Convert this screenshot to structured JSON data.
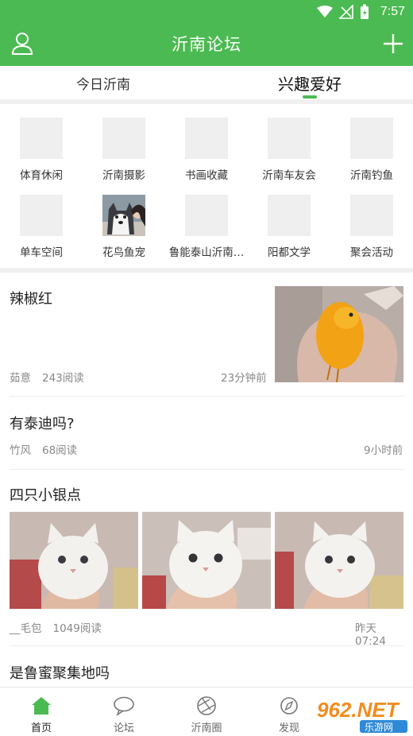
{
  "status_bar": {
    "time": "7:57",
    "icons": [
      "wifi-icon",
      "no-signal-icon",
      "battery-icon"
    ]
  },
  "header": {
    "title": "沂南论坛",
    "left_icon": "user-icon",
    "right_icon": "plus-icon"
  },
  "tabs": [
    {
      "label": "今日沂南",
      "active": false
    },
    {
      "label": "兴趣爱好",
      "active": true
    }
  ],
  "categories": [
    {
      "label": "体育休闲"
    },
    {
      "label": "沂南摄影"
    },
    {
      "label": "书画收藏"
    },
    {
      "label": "沂南车友会"
    },
    {
      "label": "沂南钓鱼"
    },
    {
      "label": "单车空间"
    },
    {
      "label": "花鸟鱼宠"
    },
    {
      "label": "鲁能泰山沂南…"
    },
    {
      "label": "阳都文学"
    },
    {
      "label": "聚会活动"
    }
  ],
  "posts": [
    {
      "title": "辣椒红",
      "author": "茹意",
      "reads": "243阅读",
      "time": "23分钟前"
    },
    {
      "title": "有泰迪吗?",
      "author": "竹风",
      "reads": "68阅读",
      "time": "9小时前"
    },
    {
      "title": "四只小银点",
      "author": "__毛包",
      "reads": "1049阅读",
      "time": "昨天07:24"
    },
    {
      "title": "是鲁蜜聚集地吗"
    }
  ],
  "bottom_nav": [
    {
      "label": "首页",
      "icon": "home-icon",
      "active": true
    },
    {
      "label": "论坛",
      "icon": "chat-bubble-icon",
      "active": false
    },
    {
      "label": "沂南圈",
      "icon": "aperture-icon",
      "active": false
    },
    {
      "label": "发现",
      "icon": "compass-icon",
      "active": false
    }
  ],
  "watermark": {
    "brand": "962.NET",
    "sub": "乐游网"
  },
  "colors": {
    "primary": "#4cba52",
    "background": "#ffffff",
    "separator": "#f0f0f0",
    "muted_text": "#888888"
  }
}
